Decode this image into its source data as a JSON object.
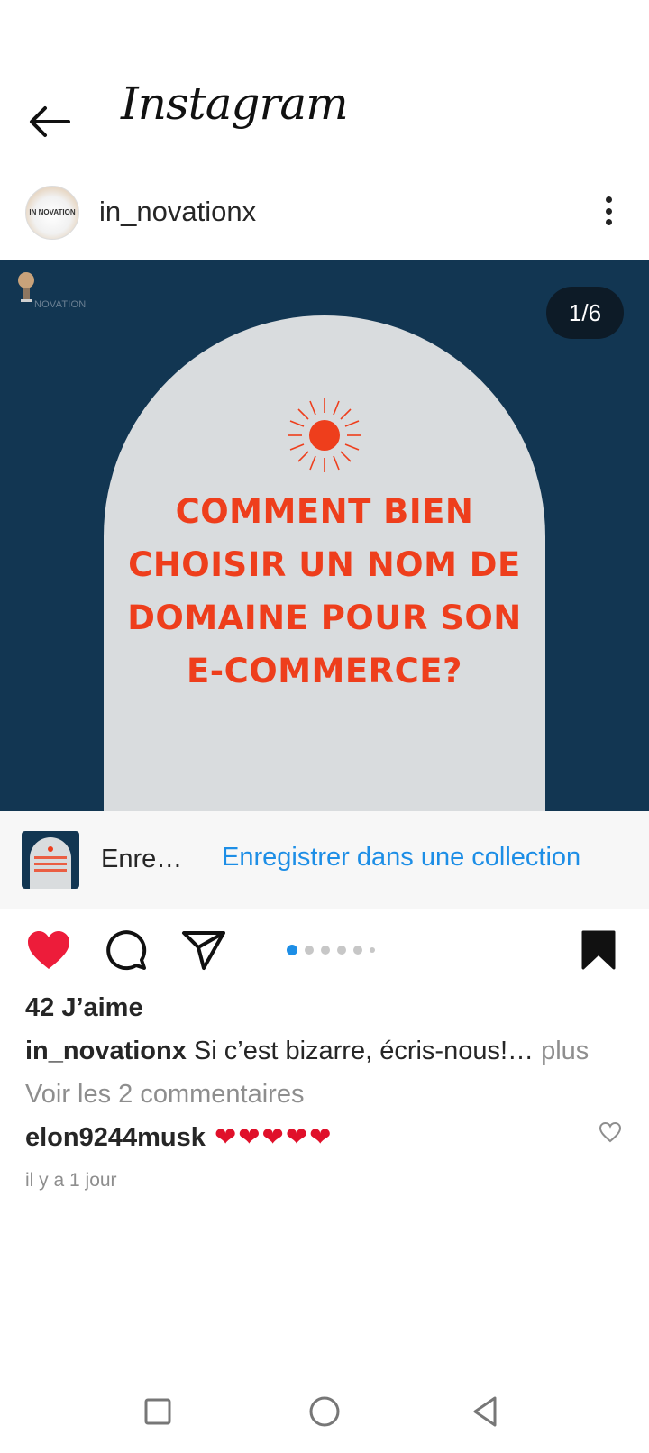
{
  "app": {
    "title": "Instagram"
  },
  "post": {
    "username": "in_novationx",
    "avatar_text": "IN NOVATION",
    "media_brand_text": "NOVATION",
    "counter": "1/6",
    "headline_lines": [
      "COMMENT BIEN",
      "CHOISIR UN NOM DE",
      "DOMAINE POUR SON",
      "E-COMMERCE?"
    ]
  },
  "save_banner": {
    "label": "Enre…",
    "link": "Enregistrer dans une collection"
  },
  "carousel": {
    "total_visible_dots": 6,
    "active_index": 0
  },
  "engagement": {
    "likes": "42 J’aime",
    "caption_user": "in_novationx",
    "caption_text": " Si c’est bizarre, écris-nous!…",
    "caption_more": " plus",
    "view_comments": "Voir les 2 commentaires",
    "comment_user": "elon9244musk",
    "comment_text": " ❤❤❤❤❤",
    "timestamp": "il y a 1 jour"
  },
  "icons": {
    "back": "arrow-left-icon",
    "more": "more-vertical-icon",
    "like": "heart-filled-icon",
    "comment": "comment-icon",
    "share": "send-icon",
    "save": "bookmark-filled-icon",
    "nav_recents": "square-icon",
    "nav_home": "circle-icon",
    "nav_back": "triangle-back-icon"
  },
  "colors": {
    "media_bg": "#123652",
    "arch_bg": "#d9dcde",
    "headline": "#ee3e1c",
    "link": "#1d8ee6",
    "like": "#ed1c3a",
    "active_dot": "#1d8ee6"
  }
}
